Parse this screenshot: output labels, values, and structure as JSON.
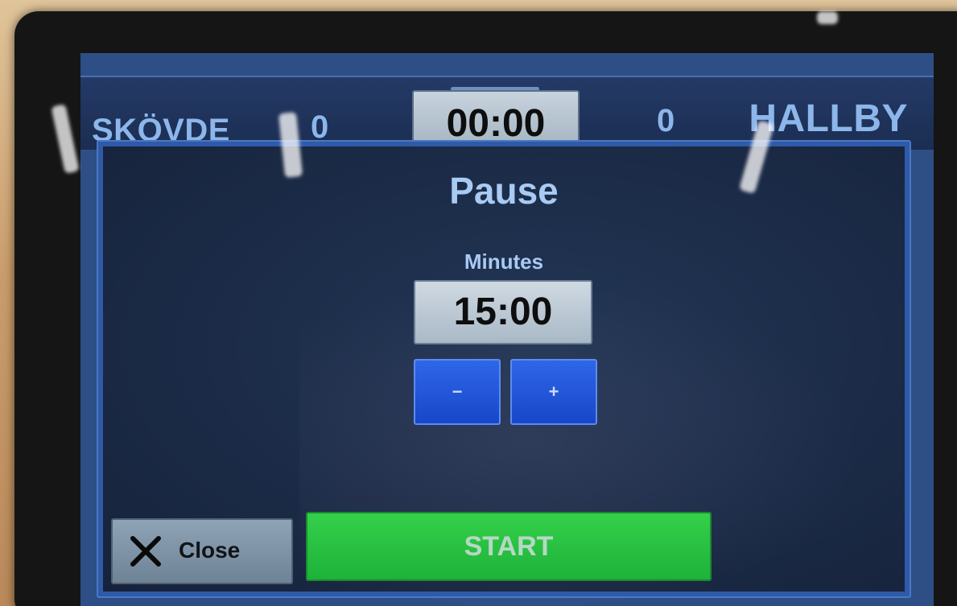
{
  "scoreboard": {
    "home_team": "SKÖVDE",
    "home_score": "0",
    "clock": "00:00",
    "away_score": "0",
    "away_team": "HALLBY"
  },
  "dialog": {
    "title": "Pause",
    "minutes_label": "Minutes",
    "minutes_value": "15:00",
    "decrement_label": "−",
    "increment_label": "+",
    "close_label": "Close",
    "start_label": "START"
  },
  "colors": {
    "accent_blue": "#2f66e8",
    "start_green": "#1eb23a",
    "text_light_blue": "#a9caf2",
    "close_grey": "#8fa3b6"
  },
  "icons": {
    "close": "close-icon"
  }
}
